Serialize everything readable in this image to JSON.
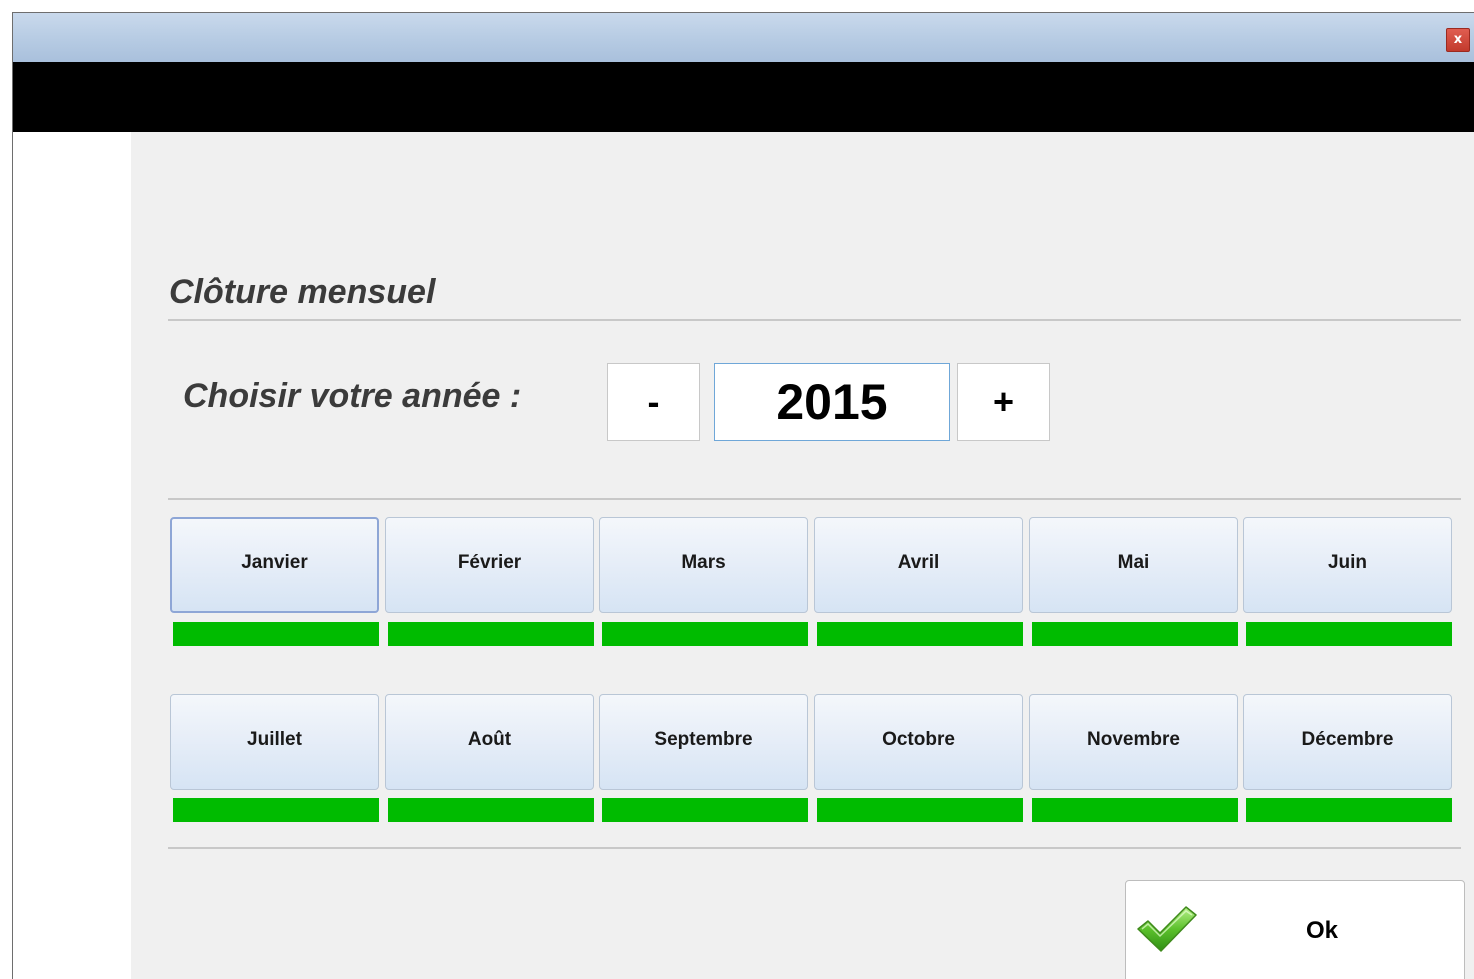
{
  "window": {
    "close_label": "x"
  },
  "page": {
    "title": "Clôture mensuel",
    "year_label": "Choisir votre année :"
  },
  "year_selector": {
    "decrement_label": "-",
    "value": "2015",
    "increment_label": "+"
  },
  "months": [
    {
      "label": "Janvier",
      "status_color": "#00bb00",
      "focused": true
    },
    {
      "label": "Février",
      "status_color": "#00bb00"
    },
    {
      "label": "Mars",
      "status_color": "#00bb00"
    },
    {
      "label": "Avril",
      "status_color": "#00bb00"
    },
    {
      "label": "Mai",
      "status_color": "#00bb00"
    },
    {
      "label": "Juin",
      "status_color": "#00bb00"
    },
    {
      "label": "Juillet",
      "status_color": "#00bb00"
    },
    {
      "label": "Août",
      "status_color": "#00bb00"
    },
    {
      "label": "Septembre",
      "status_color": "#00bb00"
    },
    {
      "label": "Octobre",
      "status_color": "#00bb00"
    },
    {
      "label": "Novembre",
      "status_color": "#00bb00"
    },
    {
      "label": "Décembre",
      "status_color": "#00bb00"
    }
  ],
  "footer": {
    "ok_label": "Ok",
    "ok_icon": "checkmark-icon"
  },
  "colors": {
    "status_ok": "#00bb00",
    "header_black": "#000000",
    "close_red": "#c23a2d"
  }
}
